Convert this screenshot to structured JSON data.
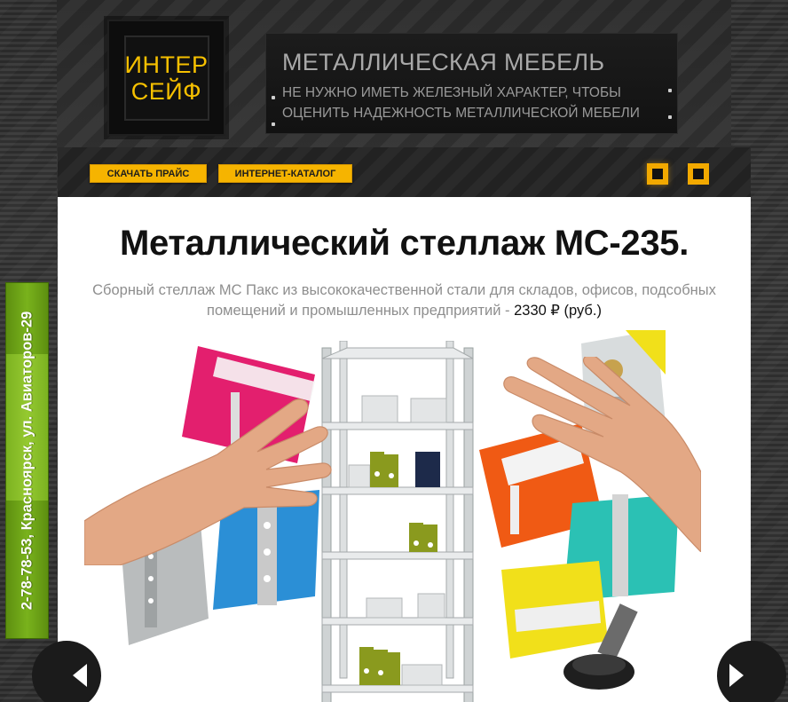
{
  "brand": {
    "logo_line1": "ИНТЕР",
    "logo_line2": "СЕЙФ",
    "accent_color": "#f6c000"
  },
  "header": {
    "title": "МЕТАЛЛИЧЕСКАЯ МЕБЕЛЬ",
    "tagline_line1": "НЕ НУЖНО ИМЕТЬ ЖЕЛЕЗНЫЙ ХАРАКТЕР, ЧТОБЫ",
    "tagline_line2": "ОЦЕНИТЬ НАДЕЖНОСТЬ МЕТАЛЛИЧЕСКОЙ МЕБЕЛИ"
  },
  "nav": {
    "download_price": "СКАЧАТЬ ПРАЙС",
    "catalog": "ИНТЕРНЕТ-КАТАЛОГ"
  },
  "slider": {
    "dots": [
      "slide-1",
      "slide-2"
    ],
    "active_index": 0,
    "prev_icon": "chevron-left-icon",
    "next_icon": "chevron-right-icon"
  },
  "slide": {
    "title": "Металлический стеллаж МС-235.",
    "description": "Сборный стеллаж МС Пакс из высококачественной стали для складов, офисов, подсобных помещений и промышленных предприятий - ",
    "price": "2330 ₽",
    "price_suffix": " (руб.)"
  },
  "sidebar": {
    "contact": "2-78-78-53, Красноярск, ул. Авиаторов-29",
    "color": "#6fa318"
  },
  "colors": {
    "pink": "#e31f6e",
    "blue": "#2b8fd6",
    "orange": "#f05a14",
    "yellow": "#f1e01a",
    "teal": "#2bc1b4",
    "binder_green": "#8a9a1e",
    "binder_navy": "#1d2a4a"
  }
}
